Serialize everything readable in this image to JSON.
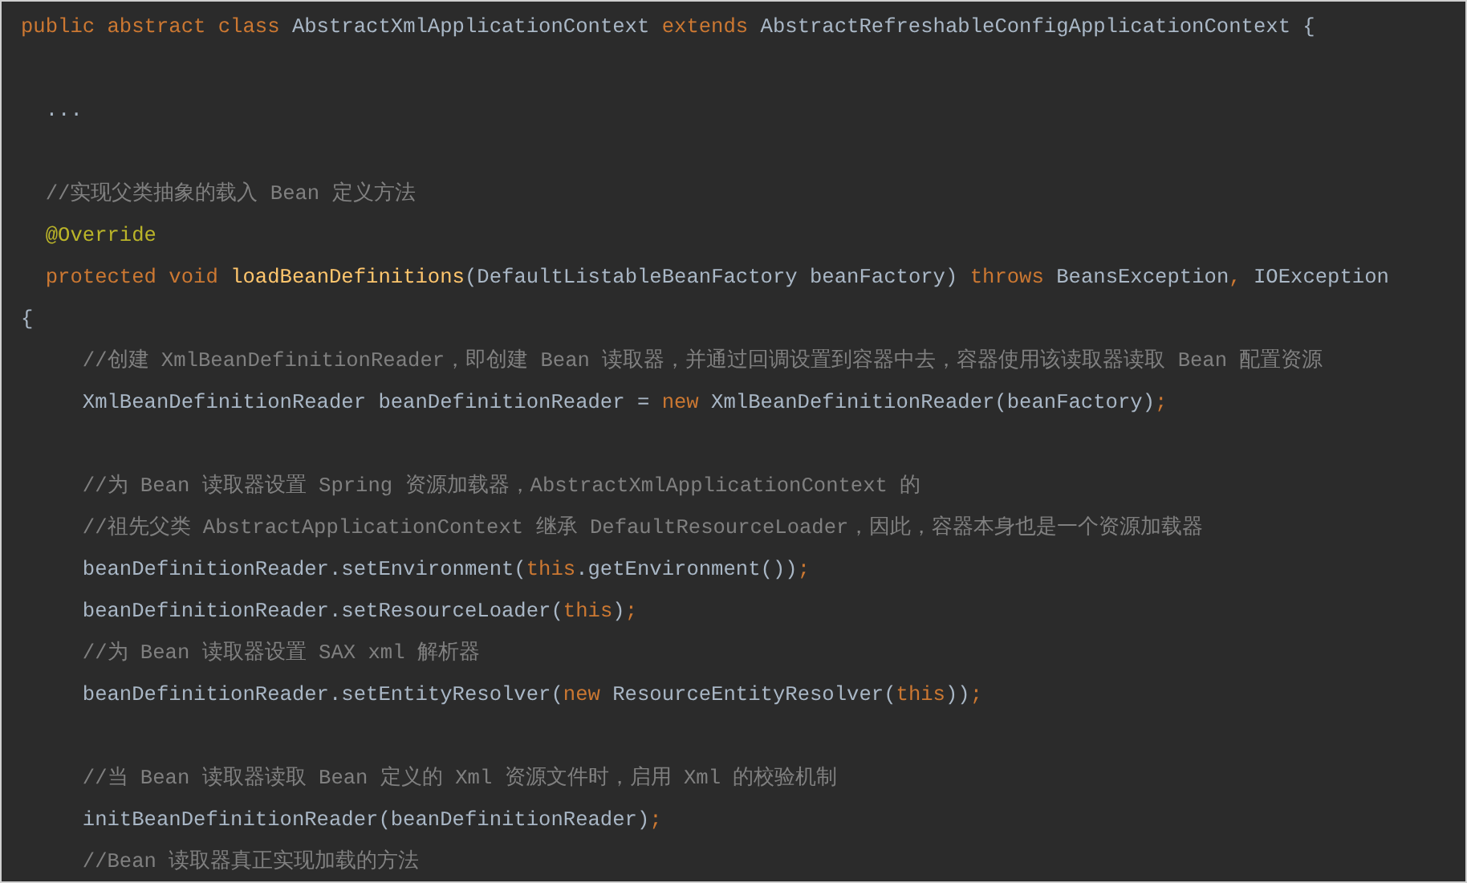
{
  "code_lines": [
    {
      "kind": "code",
      "tokens": [
        {
          "kind": "keyword",
          "text": "public abstract class "
        },
        {
          "kind": "plain",
          "text": "AbstractXmlApplicationContext "
        },
        {
          "kind": "keyword",
          "text": "extends "
        },
        {
          "kind": "plain",
          "text": "AbstractRefreshableConfigApplicationContext {"
        }
      ]
    },
    {
      "kind": "blank"
    },
    {
      "kind": "code",
      "tokens": [
        {
          "kind": "plain",
          "text": "  ..."
        }
      ]
    },
    {
      "kind": "blank"
    },
    {
      "kind": "code",
      "tokens": [
        {
          "kind": "comment",
          "text": "  //实现父类抽象的载入 Bean 定义方法"
        }
      ]
    },
    {
      "kind": "code",
      "tokens": [
        {
          "kind": "annotation",
          "text": "  @Override"
        }
      ]
    },
    {
      "kind": "code",
      "tokens": [
        {
          "kind": "keyword",
          "text": "  protected void "
        },
        {
          "kind": "method",
          "text": "loadBeanDefinitions"
        },
        {
          "kind": "plain",
          "text": "(DefaultListableBeanFactory beanFactory) "
        },
        {
          "kind": "keyword",
          "text": "throws "
        },
        {
          "kind": "plain",
          "text": "BeansException"
        },
        {
          "kind": "keyword",
          "text": ", "
        },
        {
          "kind": "plain",
          "text": "IOException"
        }
      ]
    },
    {
      "kind": "code",
      "tokens": [
        {
          "kind": "plain",
          "text": "{"
        }
      ]
    },
    {
      "kind": "code",
      "tokens": [
        {
          "kind": "comment",
          "text": "     //创建 XmlBeanDefinitionReader，即创建 Bean 读取器，并通过回调设置到容器中去，容器使用该读取器读取 Bean 配置资源"
        }
      ]
    },
    {
      "kind": "code",
      "tokens": [
        {
          "kind": "plain",
          "text": "     XmlBeanDefinitionReader beanDefinitionReader = "
        },
        {
          "kind": "keyword",
          "text": "new "
        },
        {
          "kind": "plain",
          "text": "XmlBeanDefinitionReader(beanFactory)"
        },
        {
          "kind": "keyword",
          "text": ";"
        }
      ]
    },
    {
      "kind": "blank"
    },
    {
      "kind": "code",
      "tokens": [
        {
          "kind": "comment",
          "text": "     //为 Bean 读取器设置 Spring 资源加载器，AbstractXmlApplicationContext 的"
        }
      ]
    },
    {
      "kind": "code",
      "tokens": [
        {
          "kind": "comment",
          "text": "     //祖先父类 AbstractApplicationContext 继承 DefaultResourceLoader，因此，容器本身也是一个资源加载器"
        }
      ]
    },
    {
      "kind": "code",
      "tokens": [
        {
          "kind": "plain",
          "text": "     beanDefinitionReader.setEnvironment("
        },
        {
          "kind": "keyword",
          "text": "this"
        },
        {
          "kind": "plain",
          "text": ".getEnvironment())"
        },
        {
          "kind": "keyword",
          "text": ";"
        }
      ]
    },
    {
      "kind": "code",
      "tokens": [
        {
          "kind": "plain",
          "text": "     beanDefinitionReader.setResourceLoader("
        },
        {
          "kind": "keyword",
          "text": "this"
        },
        {
          "kind": "plain",
          "text": ")"
        },
        {
          "kind": "keyword",
          "text": ";"
        }
      ]
    },
    {
      "kind": "code",
      "tokens": [
        {
          "kind": "comment",
          "text": "     //为 Bean 读取器设置 SAX xml 解析器"
        }
      ]
    },
    {
      "kind": "code",
      "tokens": [
        {
          "kind": "plain",
          "text": "     beanDefinitionReader.setEntityResolver("
        },
        {
          "kind": "keyword",
          "text": "new "
        },
        {
          "kind": "plain",
          "text": "ResourceEntityResolver("
        },
        {
          "kind": "keyword",
          "text": "this"
        },
        {
          "kind": "plain",
          "text": "))"
        },
        {
          "kind": "keyword",
          "text": ";"
        }
      ]
    },
    {
      "kind": "blank"
    },
    {
      "kind": "code",
      "tokens": [
        {
          "kind": "comment",
          "text": "     //当 Bean 读取器读取 Bean 定义的 Xml 资源文件时，启用 Xml 的校验机制"
        }
      ]
    },
    {
      "kind": "code",
      "tokens": [
        {
          "kind": "plain",
          "text": "     initBeanDefinitionReader(beanDefinitionReader)"
        },
        {
          "kind": "keyword",
          "text": ";"
        }
      ]
    },
    {
      "kind": "code",
      "tokens": [
        {
          "kind": "comment",
          "text": "     //Bean 读取器真正实现加载的方法"
        }
      ]
    }
  ]
}
